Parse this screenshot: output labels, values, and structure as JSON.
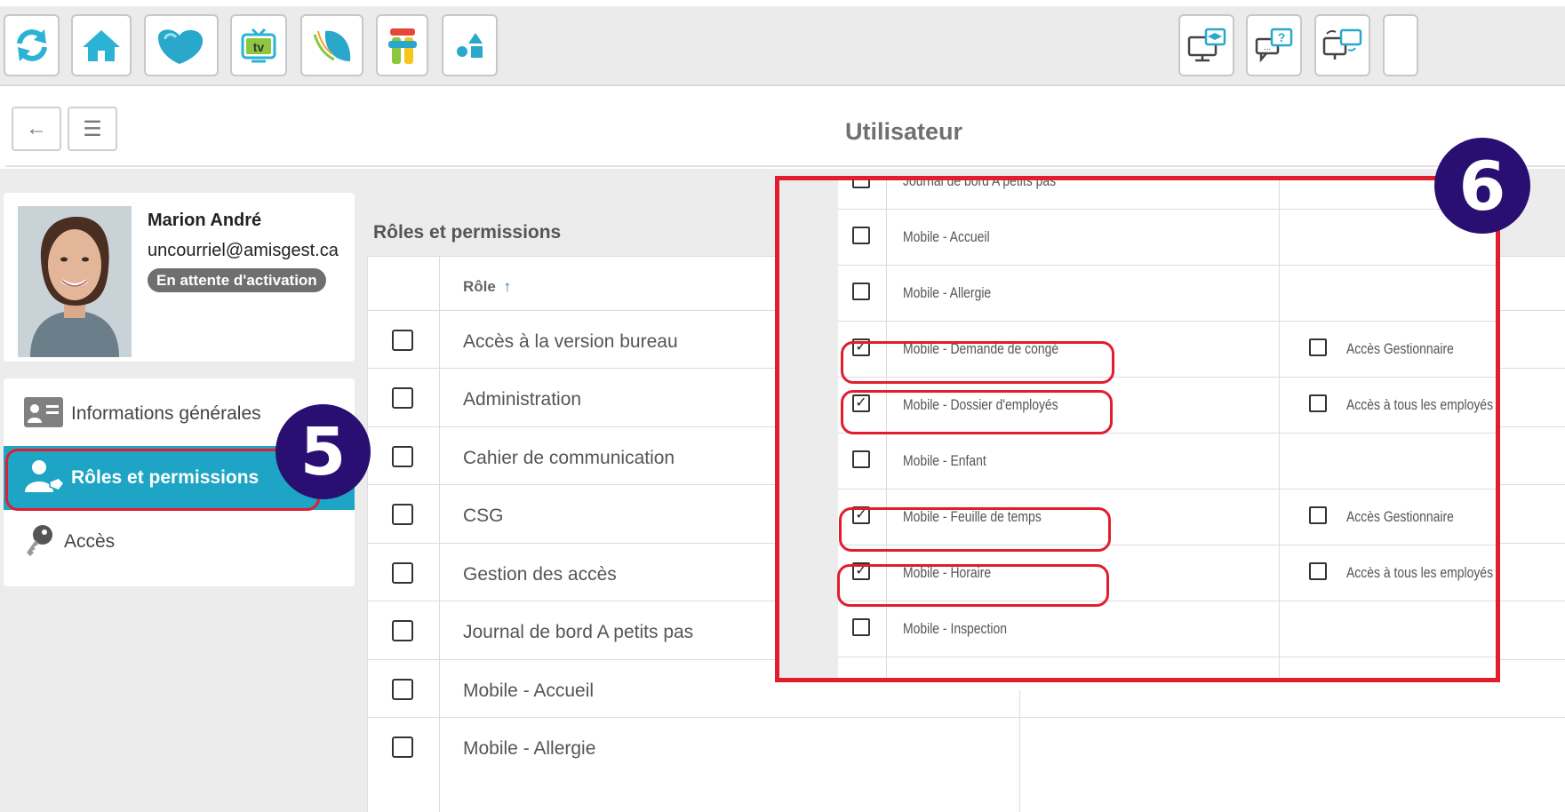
{
  "toolbar": {
    "left_buttons": [
      "refresh-icon",
      "home-icon",
      "heart-cloud-icon",
      "tv-icon",
      "leaf-icon",
      "character-icon",
      "shapes-icon"
    ],
    "right_buttons": [
      "monitor-graduation-icon",
      "help-chat-icon",
      "monitor-sync-icon"
    ],
    "tv_label": "tv"
  },
  "header": {
    "back_icon": "←",
    "menu_icon": "☰",
    "title": "Utilisateur"
  },
  "user": {
    "name": "Marion André",
    "email": "uncourriel@amisgest.ca",
    "status": "En attente d'activation"
  },
  "nav": {
    "items": [
      {
        "label": "Informations générales",
        "icon": "id-card-icon"
      },
      {
        "label": "Rôles et permissions",
        "icon": "user-tag-icon",
        "active": true
      },
      {
        "label": "Accès",
        "icon": "key-icon"
      }
    ]
  },
  "section": {
    "title": "Rôles et permissions"
  },
  "table": {
    "column_role": "Rôle",
    "sort_icon": "↑",
    "rows": [
      "Accès à la version bureau",
      "Administration",
      "Cahier de communication",
      "CSG",
      "Gestion des accès",
      "Journal de bord A petits pas",
      "Mobile - Accueil",
      "Mobile - Allergie"
    ]
  },
  "zoom": {
    "rows": [
      {
        "label": "Journal de bord A petits pas",
        "checked": false,
        "extra": ""
      },
      {
        "label": "Mobile - Accueil",
        "checked": false,
        "extra": ""
      },
      {
        "label": "Mobile - Allergie",
        "checked": false,
        "extra": ""
      },
      {
        "label": "Mobile - Demande de congé",
        "checked": true,
        "extra": "Accès Gestionnaire"
      },
      {
        "label": "Mobile - Dossier d'employés",
        "checked": true,
        "extra": "Accès à tous les employés"
      },
      {
        "label": "Mobile - Enfant",
        "checked": false,
        "extra": ""
      },
      {
        "label": "Mobile - Feuille de temps",
        "checked": true,
        "extra": "Accès Gestionnaire"
      },
      {
        "label": "Mobile - Horaire",
        "checked": true,
        "extra": "Accès à tous les employés"
      },
      {
        "label": "Mobile - Inspection",
        "checked": false,
        "extra": ""
      }
    ]
  },
  "callouts": {
    "step5": "5",
    "step6": "6",
    "color": "#e11d2e",
    "badge_color": "#2a0f73"
  },
  "colors": {
    "accent": "#1ea4c4",
    "badge_bg": "#6f6f6f"
  }
}
